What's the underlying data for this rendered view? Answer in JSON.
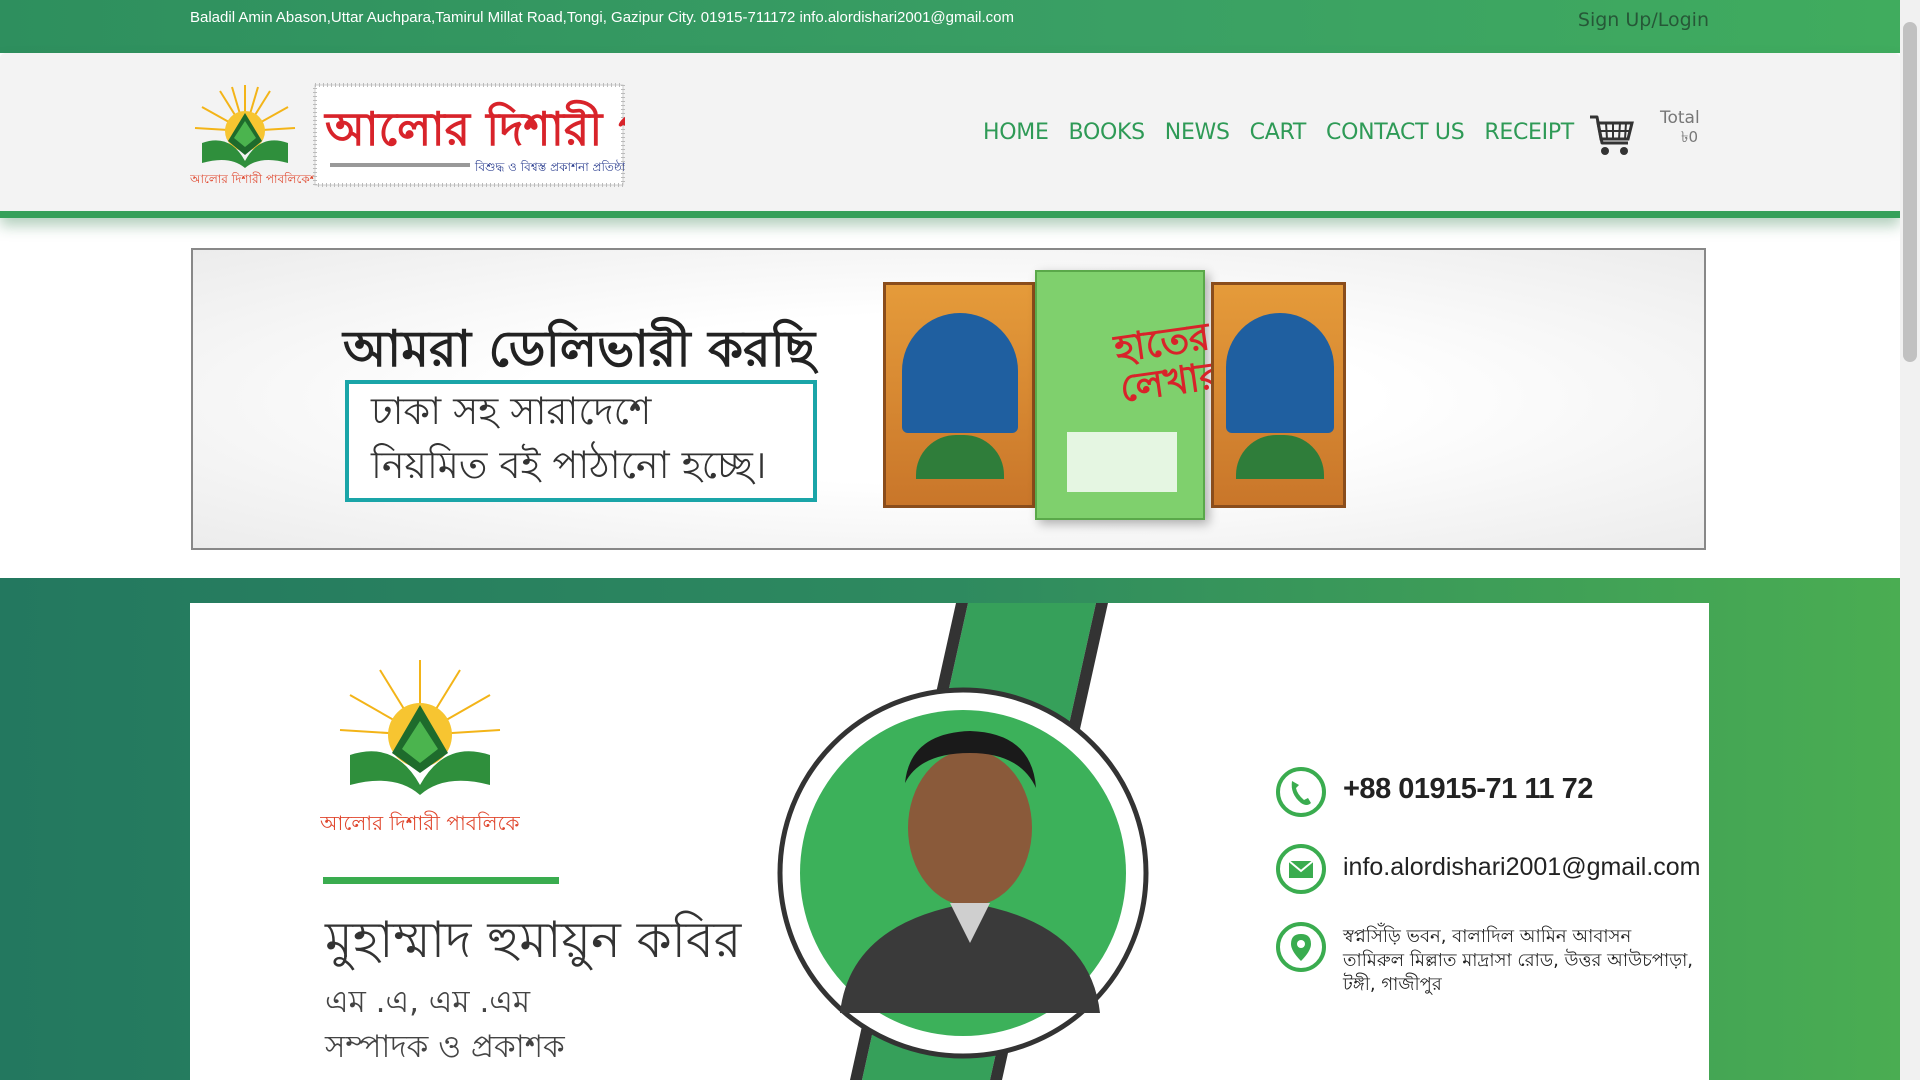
{
  "topbar": {
    "address": "Baladil Amin Abason,Uttar Auchpara,Tamirul Millat Road,Tongi, Gazipur City. 01915-711172 info.alordishari2001@gmail.com",
    "login": "Sign Up/Login"
  },
  "brand": {
    "logo_text": "আলোর দিশারী পাবলিকেশন্স",
    "logo_tagline": "বিশুদ্ধ ও বিশ্বস্ত প্রকাশনা প্রতিষ্ঠান"
  },
  "nav": {
    "items": [
      "HOME",
      "BOOKS",
      "NEWS",
      "CART",
      "CONTACT US",
      "RECEIPT"
    ]
  },
  "cart": {
    "total_label": "Total",
    "total_value": "৳0"
  },
  "banner": {
    "headline": "আমরা ডেলিভারী করছি",
    "line1": "ঢাকা সহ সারাদেশে",
    "line2": "নিয়মিত বই পাঠানো হচ্ছে।"
  },
  "card": {
    "brand_small": "আলোর দিশারী পাবলিকেশন্স",
    "name": "মুহাম্মাদ হুমায়ুন কবির",
    "degree": "এম .এ, এম .এম",
    "role": "সম্পাদক ও প্রকাশক",
    "phone": "+88 01915-71 11 72",
    "email": "info.alordishari2001@gmail.com",
    "address_line1": "স্বপ্নসিঁড়ি ভবন, বালাদিল আমিন আবাসন",
    "address_line2": "তামিরুল মিল্লাত মাদ্রাসা রোড, উত্তর আউচপাড়া,",
    "address_line3": "টঙ্গী, গাজীপুর"
  },
  "colors": {
    "brand_green": "#36a05a",
    "nav_green": "#2e9a56",
    "logo_red": "#d8232a",
    "teal": "#1aa5a8"
  }
}
